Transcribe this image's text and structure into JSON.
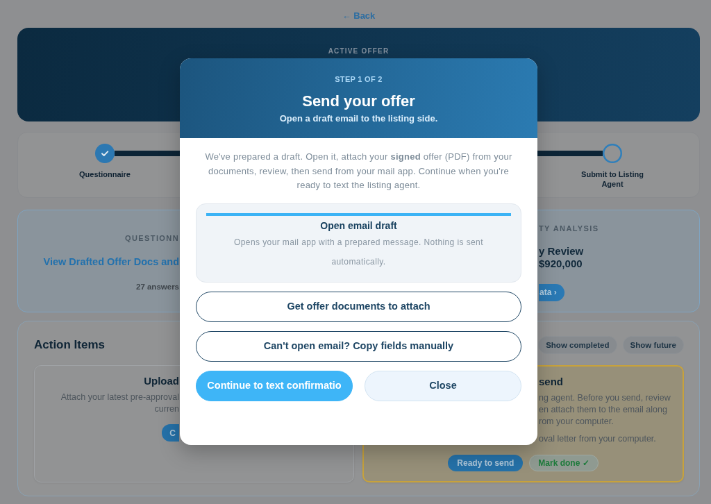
{
  "back_link": "← Back",
  "hero": {
    "label": "ACTIVE OFFER"
  },
  "stepper": {
    "steps": [
      {
        "label": "Questionnaire",
        "completed": true
      },
      {
        "label": "Submit to Listing Agent",
        "completed": false
      }
    ]
  },
  "questionnaire_card": {
    "label": "QUESTIONN",
    "link": "View Drafted Offer Docs and",
    "meta": "27 answers"
  },
  "analysis_card": {
    "label": "TY ANALYSIS",
    "lines": [
      "y Review",
      "$920,000"
    ],
    "button": "ata ›"
  },
  "action_items": {
    "title": "Action Items",
    "filters": [
      "Show completed",
      "Show future"
    ],
    "tasks": [
      {
        "title": "Upload",
        "lines": [
          "Attach your latest pre-approval",
          "curren"
        ],
        "buttons": [
          {
            "label": "C",
            "kind": "primary"
          }
        ],
        "highlighted": false
      },
      {
        "title": "send",
        "lines": [
          "ng agent. Before you send, review",
          "en attach them to the email along",
          "rom your computer."
        ],
        "note": "oval letter from your computer.",
        "buttons": [
          {
            "label": "Ready to send",
            "kind": "primary"
          },
          {
            "label": "Mark done ✓",
            "kind": "done"
          }
        ],
        "highlighted": true
      }
    ]
  },
  "modal": {
    "step": "STEP 1 OF 2",
    "title": "Send your offer",
    "subtitle": "Open a draft email to the listing side.",
    "message": "We've prepared a draft. Open it, attach your **signed** offer (PDF) from your documents, review, then send from your mail app. Continue when you're ready to text the listing agent.",
    "option": {
      "title": "Open email draft",
      "description": "Opens your mail app with a prepared message. Nothing is sent automatically."
    },
    "action_buttons": [
      "Get offer documents to attach",
      "Can't open email? Copy fields manually"
    ],
    "footer_buttons": [
      {
        "label": "Continue to text confirmatio",
        "kind": "primary"
      },
      {
        "label": "Close",
        "kind": "secondary"
      }
    ]
  }
}
